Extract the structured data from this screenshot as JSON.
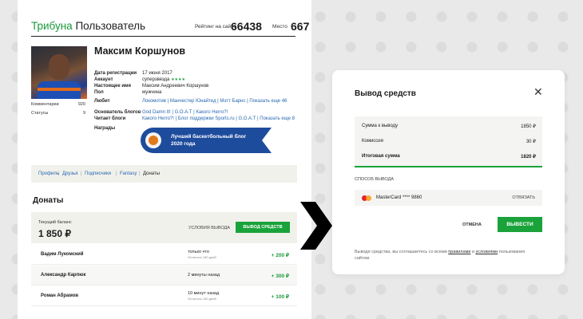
{
  "header": {
    "brand_green": "Трибуна",
    "brand_dark": "Пользователь",
    "rating_label": "Рейтинг на сайте",
    "rating_value": "66438",
    "place_label": "Место",
    "place_value": "667"
  },
  "profile": {
    "name": "Максим Коршунов",
    "comments_label": "Комментарии",
    "comments_value": "920",
    "statuses_label": "Статусы",
    "statuses_value": "9",
    "fields": [
      {
        "key": "Дата регистрации",
        "value": "17 июня 2017"
      },
      {
        "key": "Аккаунт",
        "value": "суперзвезда"
      },
      {
        "key": "Настоящее имя",
        "value": "Максим Андреевич Коршунов"
      },
      {
        "key": "Пол",
        "value": "мужчина"
      },
      {
        "key": "Любит",
        "value": "Локомотив | Манчестер Юнайтед | Мэтт Барнс | Показать еще 46"
      },
      {
        "key": "Основатель блогов",
        "value": "God Damn It! | G.O.A.T | Какого Herro?!"
      },
      {
        "key": "Читает блоги",
        "value": "Какого Herro?! | Блог поддержки Sports.ru | G.O.A.T | Показать еще 8"
      },
      {
        "key": "Награды",
        "value": ""
      }
    ],
    "stars": "★★★★",
    "award_text": "Лучший баскетбольный блог 2020 года"
  },
  "tabs": {
    "items": [
      "Профиль",
      "Друзья",
      "Подписчики",
      "Fantasy",
      "Донаты"
    ],
    "separator": "|"
  },
  "donats": {
    "title": "Донаты",
    "balance_label": "Текущий баланс",
    "balance_value": "1 850 ₽",
    "conditions_label": "УСЛОВИЯ ВЫВОДА",
    "withdraw_label": "ВЫВОД СРЕДСТВ",
    "rows": [
      {
        "name": "Вадим Лукомский",
        "time": "только что",
        "remaining": "Осталось 150 дней",
        "amount": "+ 200 ₽"
      },
      {
        "name": "Александр Карпюк",
        "time": "2 минуты назад",
        "remaining": "",
        "amount": "+ 300 ₽"
      },
      {
        "name": "Роман Абрамов",
        "time": "10 минут назад",
        "remaining": "Осталось 150 дней",
        "amount": "+ 100 ₽"
      }
    ]
  },
  "modal": {
    "title": "Вывод средств",
    "close_symbol": "✕",
    "sum_label": "Сумма к выводу",
    "sum_value": "1850 ₽",
    "fee_label": "Комиссия",
    "fee_value": "30 ₽",
    "total_label": "Итоговая сумма",
    "total_value": "1820 ₽",
    "method_label": "СПОСОБ ВЫВОДА",
    "card_label": "MasterCard **** 9860",
    "unlink_label": "ОТВЯЗАТЬ",
    "cancel_label": "ОТМЕНА",
    "confirm_label": "ВЫВЕСТИ",
    "note_prefix": "Выводя средства, вы соглашаетесь со всеми ",
    "note_link1": "правилами",
    "note_mid": " и ",
    "note_link2": "условиями",
    "note_suffix": " пользования сайтом."
  },
  "colors": {
    "accent_green": "#1aa33a",
    "link_blue": "#2668b0",
    "award_blue": "#1e4c9c"
  }
}
